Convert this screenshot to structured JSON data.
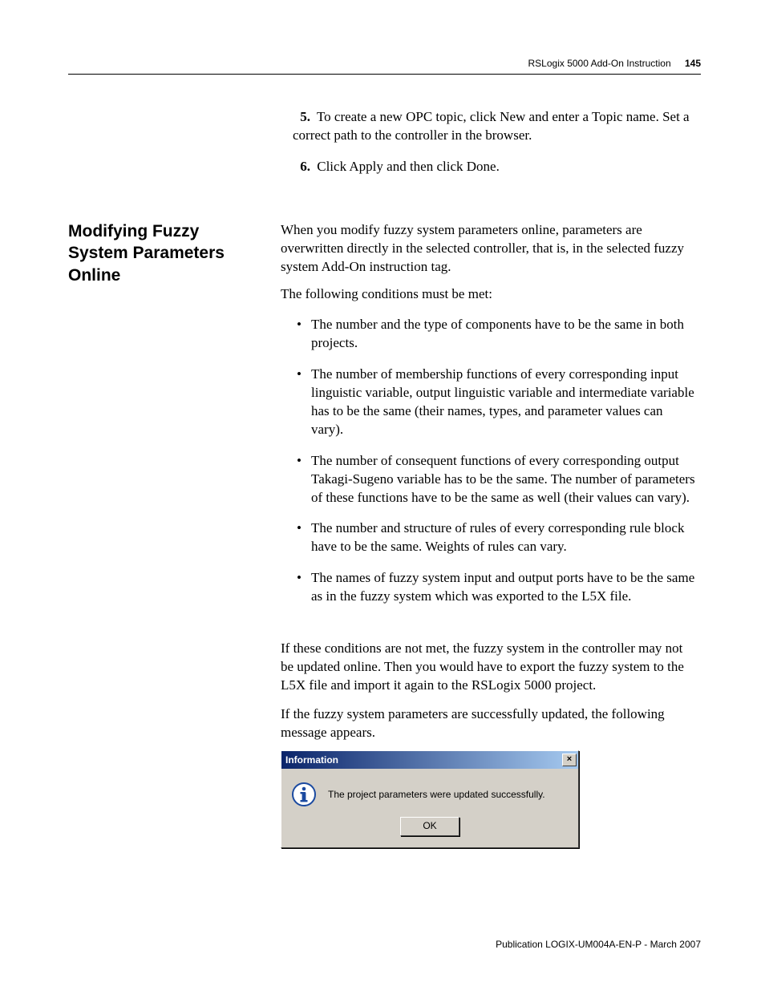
{
  "header": {
    "title": "RSLogix 5000 Add-On Instruction",
    "page_number": "145"
  },
  "steps": [
    {
      "num": "5.",
      "text": "To create a new OPC topic, click New and enter a Topic name. Set a correct path to the controller in the browser."
    },
    {
      "num": "6.",
      "text": "Click Apply and then click Done."
    }
  ],
  "section_heading": "Modifying Fuzzy System Parameters Online",
  "para1": "When you modify fuzzy system parameters online, parameters are overwritten directly in the selected controller, that is, in the selected fuzzy system Add-On instruction tag.",
  "para2": "The following conditions must be met:",
  "bullets": [
    "The number and the type of components have to be the same in both projects.",
    "The number of membership functions of every corresponding input linguistic variable, output linguistic variable and intermediate variable has to be the same (their names, types, and parameter values can vary).",
    "The number of consequent functions of every corresponding output Takagi-Sugeno variable has to be the same. The number of parameters of these functions have to be the same as well (their values can vary).",
    "The number and structure of rules of every corresponding rule block have to be the same. Weights of rules can vary.",
    "The names of fuzzy system input and output ports have to be the same as in the fuzzy system which was exported to the L5X file."
  ],
  "para3": "If these conditions are not met, the fuzzy system in the controller may not be updated online. Then you would have to export the fuzzy system to the L5X file and import it again to the RSLogix 5000 project.",
  "para4": "If the fuzzy system parameters are successfully updated, the following message appears.",
  "dialog": {
    "title": "Information",
    "message": "The project parameters were updated successfully.",
    "ok_label": "OK",
    "close_label": "×"
  },
  "footer": "Publication LOGIX-UM004A-EN-P - March 2007"
}
